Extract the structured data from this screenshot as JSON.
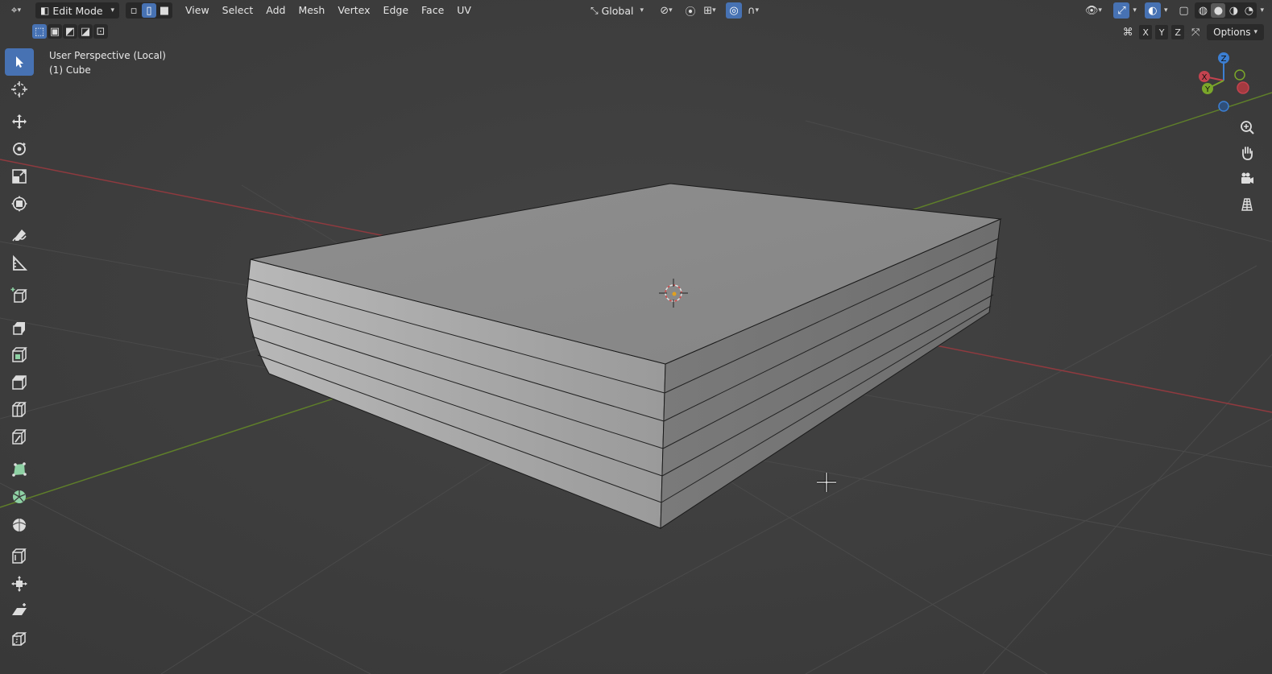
{
  "header": {
    "mode_label": "Edit Mode",
    "menus": [
      "View",
      "Select",
      "Add",
      "Mesh",
      "Vertex",
      "Edge",
      "Face",
      "UV"
    ],
    "transform_orientation": "Global"
  },
  "viewport": {
    "view_name": "User Perspective (Local)",
    "object_name": "(1) Cube"
  },
  "options": {
    "axes": [
      "X",
      "Y",
      "Z"
    ],
    "options_label": "Options"
  },
  "gizmo": {
    "axis_z": "Z",
    "axis_x": "X",
    "axis_y": "Y"
  },
  "colors": {
    "accent": "#4772b3",
    "x_axis": "#c4434f",
    "y_axis": "#7aa62a",
    "z_axis": "#3c7fd3"
  },
  "toolbar_icons": [
    "select-box-icon",
    "cursor-icon",
    "move-icon",
    "rotate-icon",
    "scale-icon",
    "transform-icon",
    "annotate-icon",
    "measure-icon",
    "add-cube-icon",
    "extrude-region-icon",
    "inset-faces-icon",
    "bevel-icon",
    "loop-cut-icon",
    "knife-icon",
    "poly-build-icon",
    "spin-icon",
    "smooth-icon",
    "edge-slide-icon",
    "shrink-fatten-icon",
    "shear-icon",
    "rip-region-icon"
  ]
}
